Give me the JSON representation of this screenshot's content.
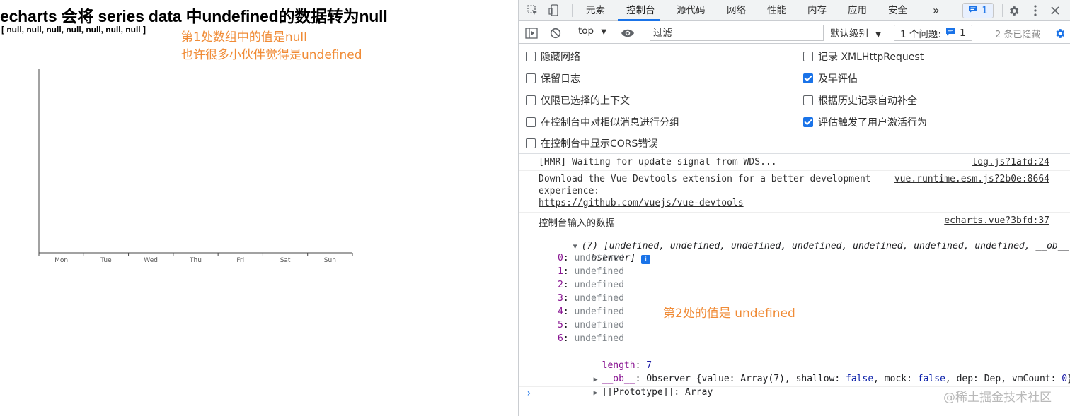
{
  "page": {
    "heading": "echarts 会将 series data 中undefined的数据转为null",
    "array_output": "[ null, null, null, null, null, null, null ]",
    "note_1": "第1处数组中的值是null",
    "note_2": "也许很多小伙伴觉得是undefined"
  },
  "chart_data": {
    "type": "line",
    "categories": [
      "Mon",
      "Tue",
      "Wed",
      "Thu",
      "Fri",
      "Sat",
      "Sun"
    ],
    "series": [
      {
        "values": [
          null,
          null,
          null,
          null,
          null,
          null,
          null
        ]
      }
    ],
    "grid": false
  },
  "devtools": {
    "tabs": [
      "元素",
      "控制台",
      "源代码",
      "网络",
      "性能",
      "内存",
      "应用",
      "安全"
    ],
    "active_tab": "控制台",
    "more_tabs": "»",
    "issues_badge_count": "1",
    "toolbar": {
      "context": "top",
      "filter_placeholder": "过滤",
      "level": "默认级别",
      "issues_label": "1 个问题:",
      "issues_count": "1",
      "hidden": "2 条已隐藏"
    },
    "settings": [
      {
        "label": "隐藏网络",
        "checked": false
      },
      {
        "label": "记录 XMLHttpRequest",
        "checked": false
      },
      {
        "label": "保留日志",
        "checked": false
      },
      {
        "label": "及早评估",
        "checked": true
      },
      {
        "label": "仅限已选择的上下文",
        "checked": false
      },
      {
        "label": "根据历史记录自动补全",
        "checked": false
      },
      {
        "label": "在控制台中对相似消息进行分组",
        "checked": false
      },
      {
        "label": "评估触发了用户激活行为",
        "checked": true
      },
      {
        "label": "在控制台中显示CORS错误",
        "checked": false
      }
    ],
    "console": {
      "msg1": {
        "text": "[HMR] Waiting for update signal from WDS...",
        "source": "log.js?1afd:24"
      },
      "msg2": {
        "line1": "Download the Vue Devtools extension for a better development",
        "line2": "experience:",
        "url": "https://github.com/vuejs/vue-devtools",
        "source": "vue.runtime.esm.js?2b0e:8664"
      },
      "msg3": {
        "label": "控制台输入的数据",
        "source": "echarts.vue?3bfd:37",
        "summary_line1": "(7) [undefined, undefined, undefined, undefined, undefined, undefined, undefined, __ob__: O",
        "summary_line2": "bserver]",
        "info": "i",
        "entries": [
          {
            "key": "0",
            "value": "undefined"
          },
          {
            "key": "1",
            "value": "undefined"
          },
          {
            "key": "2",
            "value": "undefined"
          },
          {
            "key": "3",
            "value": "undefined"
          },
          {
            "key": "4",
            "value": "undefined"
          },
          {
            "key": "5",
            "value": "undefined"
          },
          {
            "key": "6",
            "value": "undefined"
          }
        ],
        "length_key": "length",
        "length_value": "7",
        "ob_key": "__ob__",
        "ob_value_prefix": "Observer {value: Array(7), shallow: ",
        "ob_shallow": "false",
        "ob_mid1": ", mock: ",
        "ob_mock": "false",
        "ob_mid2": ", dep: Dep, vmCount: ",
        "ob_vmcount": "0",
        "ob_suffix": "}",
        "proto": "[[Prototype]]: Array"
      },
      "note_3": "第2处的值是 undefined",
      "prompt": "›"
    },
    "watermark": "@稀土掘金技术社区"
  },
  "colors": {
    "annotation": "#f08b36",
    "devtools_accent": "#1a73e8"
  }
}
